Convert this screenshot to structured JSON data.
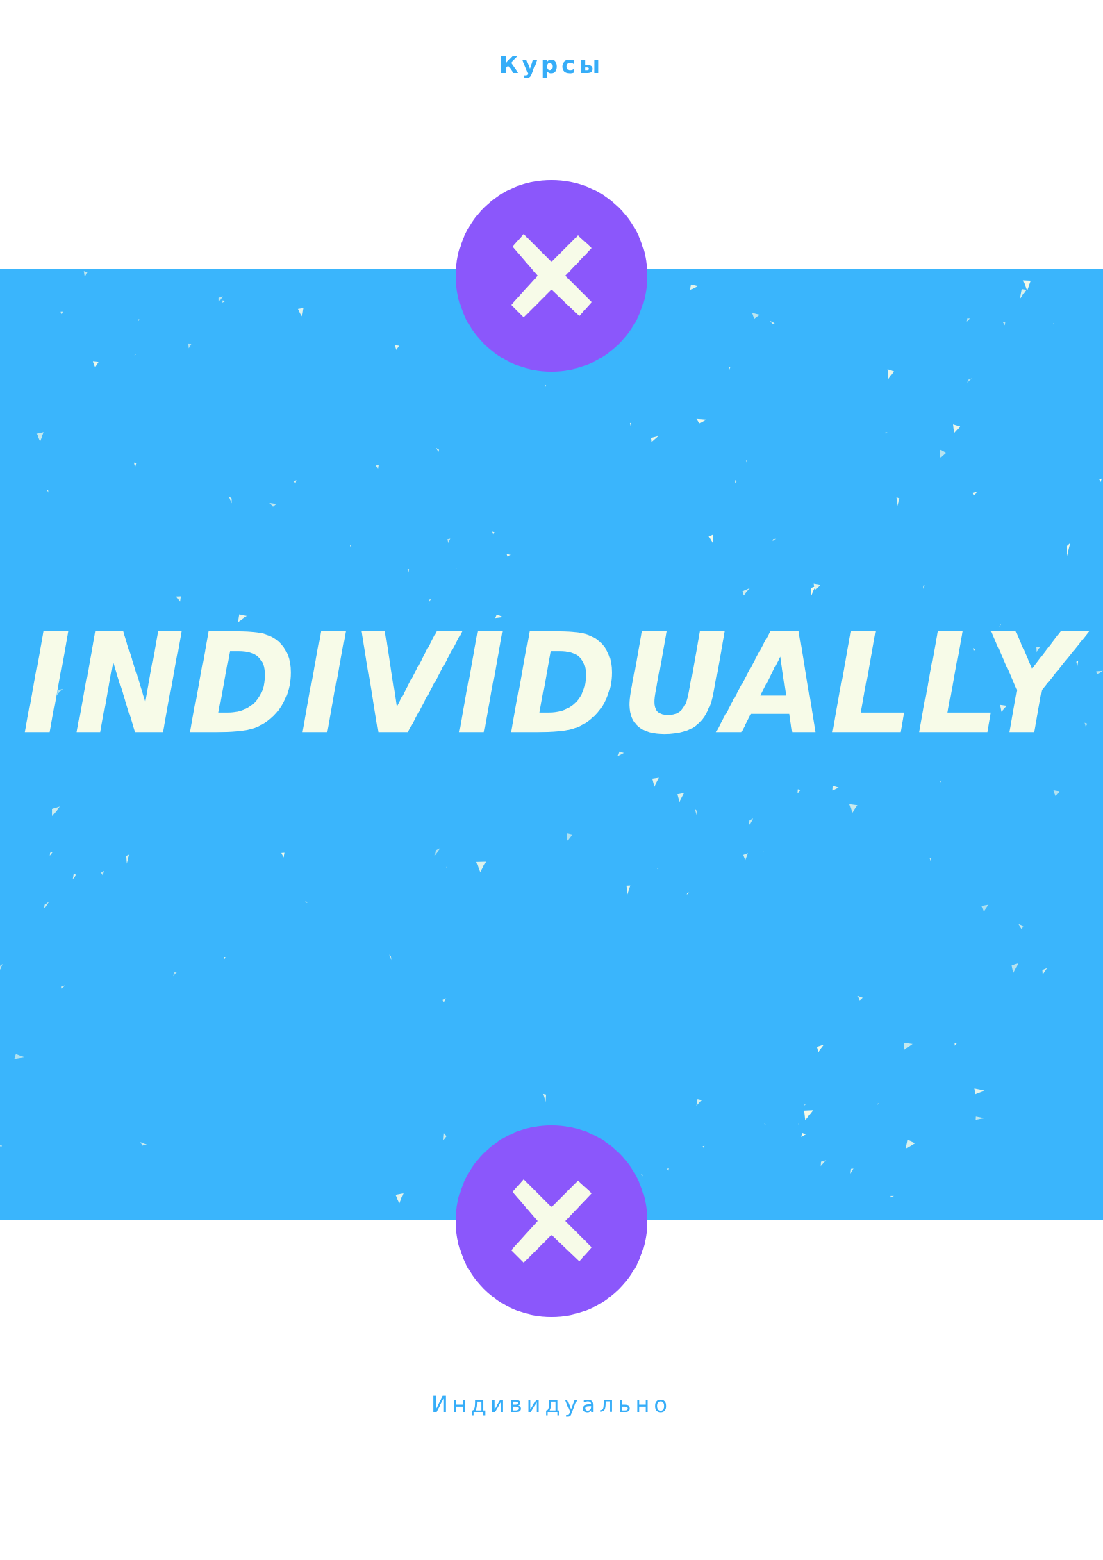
{
  "header": {
    "label": "Курсы"
  },
  "headline": {
    "text": "INDIVIDUALLY"
  },
  "footer": {
    "label": "Индивидуально"
  },
  "badges": {
    "top_icon": "close-icon",
    "bottom_icon": "close-icon"
  },
  "colors": {
    "background": "#ffffff",
    "band": "#3ab5fc",
    "accent_text": "#36adf8",
    "badge": "#8b57fb",
    "headline": "#f7fbe8",
    "mark": "#f7fbe8"
  }
}
